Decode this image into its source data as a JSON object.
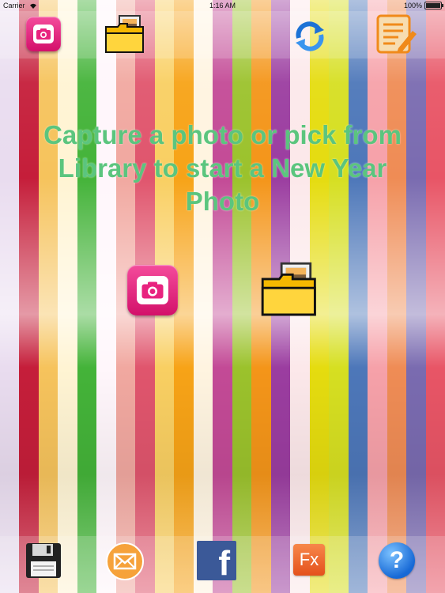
{
  "status_bar": {
    "carrier": "Carrier",
    "time": "1:16 AM",
    "battery": "100%"
  },
  "main": {
    "instruction": "Capture a photo or pick from Library to start a New Year Photo"
  },
  "top_toolbar": [
    "camera-button",
    "photo-library-button",
    "refresh-button",
    "notes-button"
  ],
  "bottom_toolbar": [
    "save-button",
    "email-button",
    "facebook-button",
    "fx-button",
    "help-button"
  ],
  "facebook_glyph": "f",
  "fx_glyph": "Fx",
  "help_glyph": "?",
  "colors": {
    "headline": "#5bc57e",
    "camera_pink": "#e8237f",
    "stripes": [
      "#e9dcef",
      "#c51e3a",
      "#f6c35c",
      "#fff4d3",
      "#44b339",
      "#fff6fb",
      "#f1a8a0",
      "#e0556d",
      "#f9cf62",
      "#f7a317",
      "#fff4e0",
      "#c34a96",
      "#9bc22c",
      "#f49519",
      "#9b3da0",
      "#fce8ea",
      "#e5dc0f",
      "#d6df21",
      "#4d77b9",
      "#f6a1a9",
      "#ef8c55",
      "#7a6bb0",
      "#e85566"
    ]
  }
}
